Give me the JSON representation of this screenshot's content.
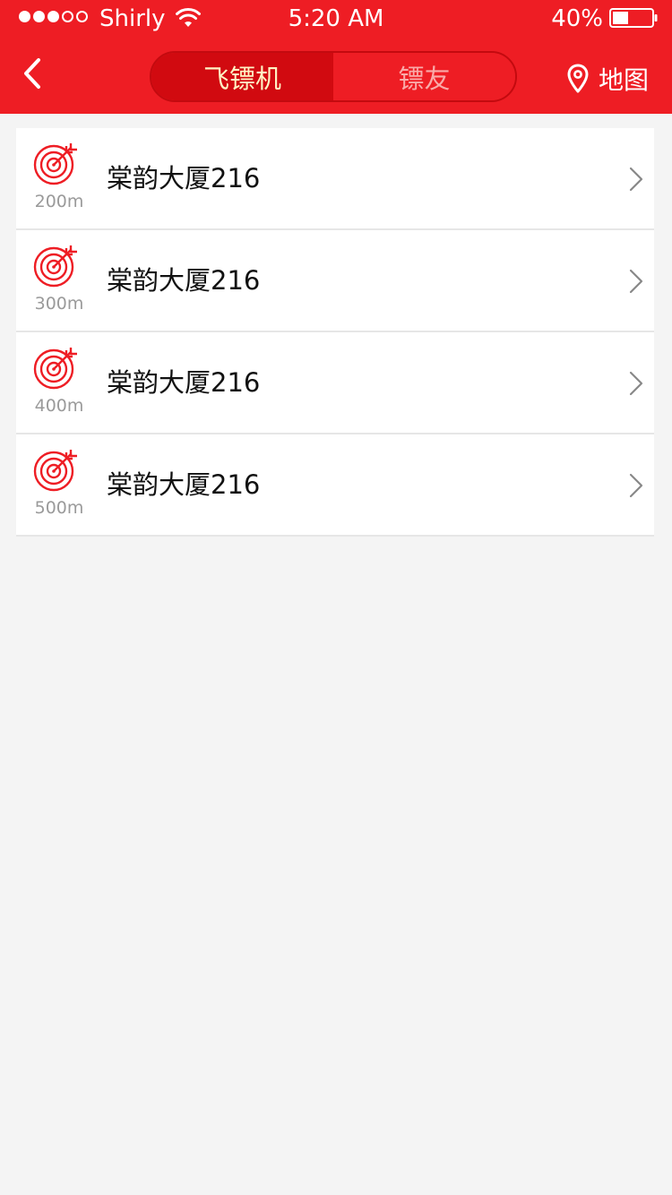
{
  "status_bar": {
    "carrier": "Shirly",
    "time": "5:20 AM",
    "battery": "40%",
    "signal_bars_full": 3,
    "signal_bars_total": 5,
    "battery_level": 0.4
  },
  "nav": {
    "back_icon": "chevron-left-icon",
    "tabs": [
      {
        "label": "飞镖机",
        "active": true
      },
      {
        "label": "镖友",
        "active": false
      }
    ],
    "map_label": "地图",
    "map_icon": "location-pin-icon"
  },
  "list": {
    "items": [
      {
        "name": "棠韵大厦216",
        "distance": "200m",
        "icon": "dartboard-icon"
      },
      {
        "name": "棠韵大厦216",
        "distance": "300m",
        "icon": "dartboard-icon"
      },
      {
        "name": "棠韵大厦216",
        "distance": "400m",
        "icon": "dartboard-icon"
      },
      {
        "name": "棠韵大厦216",
        "distance": "500m",
        "icon": "dartboard-icon"
      }
    ]
  },
  "colors": {
    "brand_red": "#ee1d24",
    "active_tab": "#d10a10",
    "active_tab_text": "#fff3c4",
    "inactive_tab_text": "#f9aaa9",
    "background": "#f4f4f4",
    "distance_text": "#9a9a9a"
  }
}
